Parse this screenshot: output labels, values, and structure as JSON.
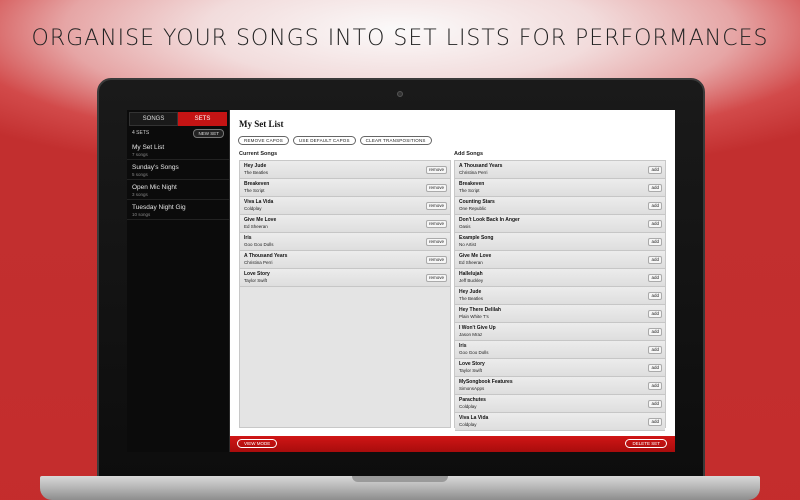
{
  "headline": "ORGANISE YOUR SONGS INTO SET LISTS FOR PERFORMANCES",
  "sidebar": {
    "tabs": [
      {
        "label": "SONGS",
        "active": false
      },
      {
        "label": "SETS",
        "active": true
      }
    ],
    "sets_count": "4 SETS",
    "new_set_label": "NEW SET",
    "items": [
      {
        "name": "My Set List",
        "sub": "7 songs"
      },
      {
        "name": "Sunday's Songs",
        "sub": "5 songs"
      },
      {
        "name": "Open Mic Night",
        "sub": "3 songs"
      },
      {
        "name": "Tuesday Night Gig",
        "sub": "10 songs"
      }
    ]
  },
  "main": {
    "title": "My Set List",
    "buttons": {
      "remove_capos": "REMOVE CAPOS",
      "use_default_capos": "USE DEFAULT CAPOS",
      "clear_transpositions": "CLEAR TRANSPOSITIONS"
    },
    "current_header": "Current Songs",
    "add_header": "Add Songs",
    "remove_label": "remove",
    "add_label": "add",
    "current_songs": [
      {
        "title": "Hey Jude",
        "artist": "The Beatles"
      },
      {
        "title": "Breakeven",
        "artist": "The Script"
      },
      {
        "title": "Viva La Vida",
        "artist": "Coldplay"
      },
      {
        "title": "Give Me Love",
        "artist": "Ed Sheeran"
      },
      {
        "title": "Iris",
        "artist": "Goo Goo Dolls"
      },
      {
        "title": "A Thousand Years",
        "artist": "Christina Perri"
      },
      {
        "title": "Love Story",
        "artist": "Taylor Swift"
      }
    ],
    "add_songs": [
      {
        "title": "A Thousand Years",
        "artist": "Christina Perri"
      },
      {
        "title": "Breakeven",
        "artist": "The Script"
      },
      {
        "title": "Counting Stars",
        "artist": "One Republic"
      },
      {
        "title": "Don't Look Back In Anger",
        "artist": "Oasis"
      },
      {
        "title": "Example Song",
        "artist": "No Artist"
      },
      {
        "title": "Give Me Love",
        "artist": "Ed Sheeran"
      },
      {
        "title": "Hallelujah",
        "artist": "Jeff Buckley"
      },
      {
        "title": "Hey Jude",
        "artist": "The Beatles"
      },
      {
        "title": "Hey There Delilah",
        "artist": "Plain White T's"
      },
      {
        "title": "I Won't Give Up",
        "artist": "Jason Mraz"
      },
      {
        "title": "Iris",
        "artist": "Goo Goo Dolls"
      },
      {
        "title": "Love Story",
        "artist": "Taylor Swift"
      },
      {
        "title": "MySongbook Features",
        "artist": "SimonsApps"
      },
      {
        "title": "Parachutes",
        "artist": "Coldplay"
      },
      {
        "title": "Viva La Vida",
        "artist": "Coldplay"
      }
    ],
    "view_mode_label": "VIEW MODE",
    "delete_set_label": "DELETE SET"
  },
  "colors": {
    "accent": "#c41414",
    "sidebar_bg": "#0b0b0b",
    "list_bg": "#e4e4e4"
  }
}
